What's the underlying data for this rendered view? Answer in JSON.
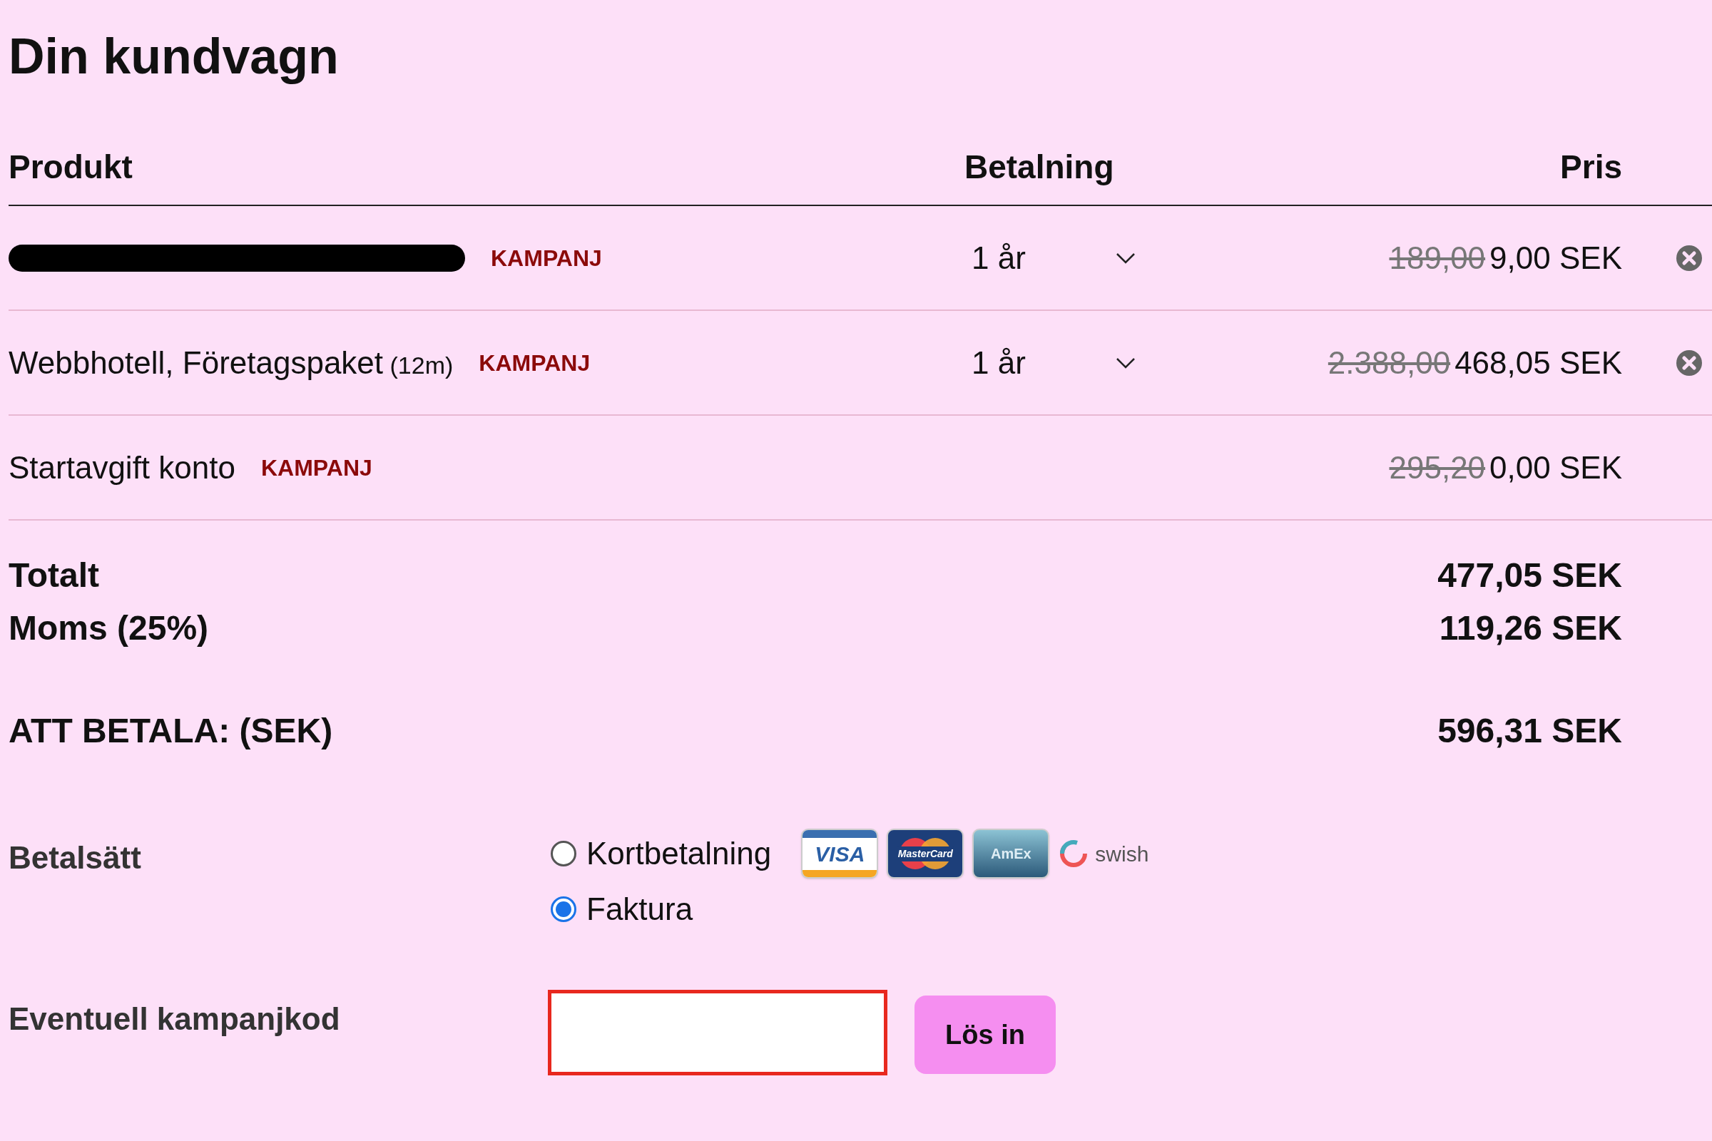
{
  "title": "Din kundvagn",
  "columns": [
    "Produkt",
    "Betalning",
    "Pris"
  ],
  "rows": [
    {
      "kind": "redacted",
      "badge": "KAMPANJ",
      "period": "1 år",
      "old_price": "189,00",
      "price": "9,00 SEK",
      "removable": true
    },
    {
      "kind": "product",
      "name": "Webbhotell, Företagspaket",
      "size": "(12m)",
      "badge": "KAMPANJ",
      "period": "1 år",
      "old_price": "2.388,00",
      "price": "468,05 SEK",
      "removable": true
    },
    {
      "kind": "fee",
      "name": "Startavgift konto",
      "badge": "KAMPANJ",
      "old_price": "295,20",
      "price": "0,00 SEK",
      "removable": false
    }
  ],
  "totals": [
    {
      "label": "Totalt",
      "value": "477,05 SEK"
    },
    {
      "label": "Moms (25%)",
      "value": "119,26 SEK"
    }
  ],
  "grand_total": {
    "label": "ATT BETALA: (SEK)",
    "value": "596,31 SEK"
  },
  "payment": {
    "label": "Betalsätt",
    "options": [
      {
        "label": "Kortbetalning",
        "selected": false
      },
      {
        "label": "Faktura",
        "selected": true
      }
    ],
    "logos": [
      {
        "kind": "visa",
        "text": "VISA"
      },
      {
        "kind": "mastercard",
        "text": "MasterCard"
      },
      {
        "kind": "amex",
        "text": "AmEx"
      },
      {
        "kind": "swish",
        "text": "swish"
      }
    ]
  },
  "campaign": {
    "label": "Eventuell kampanjkod",
    "button": "Lös in"
  }
}
